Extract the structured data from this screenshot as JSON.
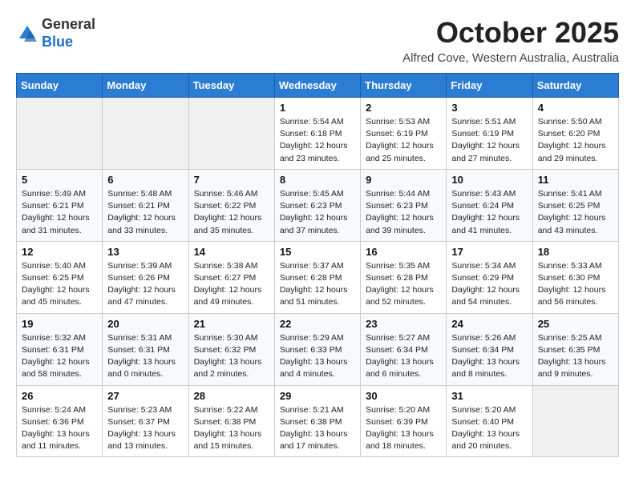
{
  "logo": {
    "general": "General",
    "blue": "Blue"
  },
  "header": {
    "month": "October 2025",
    "location": "Alfred Cove, Western Australia, Australia"
  },
  "weekdays": [
    "Sunday",
    "Monday",
    "Tuesday",
    "Wednesday",
    "Thursday",
    "Friday",
    "Saturday"
  ],
  "weeks": [
    [
      {
        "day": "",
        "info": ""
      },
      {
        "day": "",
        "info": ""
      },
      {
        "day": "",
        "info": ""
      },
      {
        "day": "1",
        "info": "Sunrise: 5:54 AM\nSunset: 6:18 PM\nDaylight: 12 hours\nand 23 minutes."
      },
      {
        "day": "2",
        "info": "Sunrise: 5:53 AM\nSunset: 6:19 PM\nDaylight: 12 hours\nand 25 minutes."
      },
      {
        "day": "3",
        "info": "Sunrise: 5:51 AM\nSunset: 6:19 PM\nDaylight: 12 hours\nand 27 minutes."
      },
      {
        "day": "4",
        "info": "Sunrise: 5:50 AM\nSunset: 6:20 PM\nDaylight: 12 hours\nand 29 minutes."
      }
    ],
    [
      {
        "day": "5",
        "info": "Sunrise: 5:49 AM\nSunset: 6:21 PM\nDaylight: 12 hours\nand 31 minutes."
      },
      {
        "day": "6",
        "info": "Sunrise: 5:48 AM\nSunset: 6:21 PM\nDaylight: 12 hours\nand 33 minutes."
      },
      {
        "day": "7",
        "info": "Sunrise: 5:46 AM\nSunset: 6:22 PM\nDaylight: 12 hours\nand 35 minutes."
      },
      {
        "day": "8",
        "info": "Sunrise: 5:45 AM\nSunset: 6:23 PM\nDaylight: 12 hours\nand 37 minutes."
      },
      {
        "day": "9",
        "info": "Sunrise: 5:44 AM\nSunset: 6:23 PM\nDaylight: 12 hours\nand 39 minutes."
      },
      {
        "day": "10",
        "info": "Sunrise: 5:43 AM\nSunset: 6:24 PM\nDaylight: 12 hours\nand 41 minutes."
      },
      {
        "day": "11",
        "info": "Sunrise: 5:41 AM\nSunset: 6:25 PM\nDaylight: 12 hours\nand 43 minutes."
      }
    ],
    [
      {
        "day": "12",
        "info": "Sunrise: 5:40 AM\nSunset: 6:25 PM\nDaylight: 12 hours\nand 45 minutes."
      },
      {
        "day": "13",
        "info": "Sunrise: 5:39 AM\nSunset: 6:26 PM\nDaylight: 12 hours\nand 47 minutes."
      },
      {
        "day": "14",
        "info": "Sunrise: 5:38 AM\nSunset: 6:27 PM\nDaylight: 12 hours\nand 49 minutes."
      },
      {
        "day": "15",
        "info": "Sunrise: 5:37 AM\nSunset: 6:28 PM\nDaylight: 12 hours\nand 51 minutes."
      },
      {
        "day": "16",
        "info": "Sunrise: 5:35 AM\nSunset: 6:28 PM\nDaylight: 12 hours\nand 52 minutes."
      },
      {
        "day": "17",
        "info": "Sunrise: 5:34 AM\nSunset: 6:29 PM\nDaylight: 12 hours\nand 54 minutes."
      },
      {
        "day": "18",
        "info": "Sunrise: 5:33 AM\nSunset: 6:30 PM\nDaylight: 12 hours\nand 56 minutes."
      }
    ],
    [
      {
        "day": "19",
        "info": "Sunrise: 5:32 AM\nSunset: 6:31 PM\nDaylight: 12 hours\nand 58 minutes."
      },
      {
        "day": "20",
        "info": "Sunrise: 5:31 AM\nSunset: 6:31 PM\nDaylight: 13 hours\nand 0 minutes."
      },
      {
        "day": "21",
        "info": "Sunrise: 5:30 AM\nSunset: 6:32 PM\nDaylight: 13 hours\nand 2 minutes."
      },
      {
        "day": "22",
        "info": "Sunrise: 5:29 AM\nSunset: 6:33 PM\nDaylight: 13 hours\nand 4 minutes."
      },
      {
        "day": "23",
        "info": "Sunrise: 5:27 AM\nSunset: 6:34 PM\nDaylight: 13 hours\nand 6 minutes."
      },
      {
        "day": "24",
        "info": "Sunrise: 5:26 AM\nSunset: 6:34 PM\nDaylight: 13 hours\nand 8 minutes."
      },
      {
        "day": "25",
        "info": "Sunrise: 5:25 AM\nSunset: 6:35 PM\nDaylight: 13 hours\nand 9 minutes."
      }
    ],
    [
      {
        "day": "26",
        "info": "Sunrise: 5:24 AM\nSunset: 6:36 PM\nDaylight: 13 hours\nand 11 minutes."
      },
      {
        "day": "27",
        "info": "Sunrise: 5:23 AM\nSunset: 6:37 PM\nDaylight: 13 hours\nand 13 minutes."
      },
      {
        "day": "28",
        "info": "Sunrise: 5:22 AM\nSunset: 6:38 PM\nDaylight: 13 hours\nand 15 minutes."
      },
      {
        "day": "29",
        "info": "Sunrise: 5:21 AM\nSunset: 6:38 PM\nDaylight: 13 hours\nand 17 minutes."
      },
      {
        "day": "30",
        "info": "Sunrise: 5:20 AM\nSunset: 6:39 PM\nDaylight: 13 hours\nand 18 minutes."
      },
      {
        "day": "31",
        "info": "Sunrise: 5:20 AM\nSunset: 6:40 PM\nDaylight: 13 hours\nand 20 minutes."
      },
      {
        "day": "",
        "info": ""
      }
    ]
  ]
}
